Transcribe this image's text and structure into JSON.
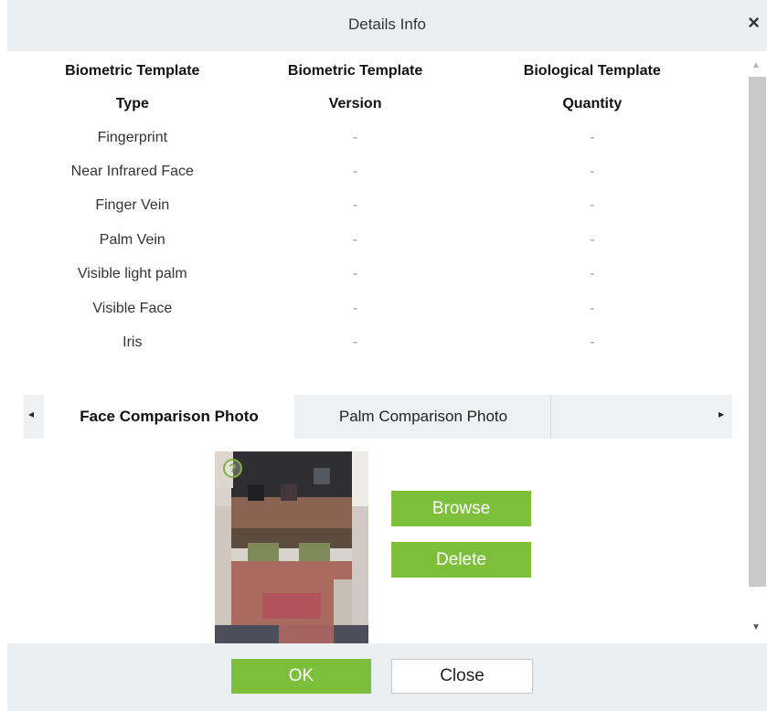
{
  "dialog": {
    "title": "Details Info",
    "close_glyph": "×"
  },
  "table": {
    "headers": [
      {
        "line1": "Biometric Template",
        "line2": "Type"
      },
      {
        "line1": "Biometric Template",
        "line2": "Version"
      },
      {
        "line1": "Biological Template",
        "line2": "Quantity"
      }
    ],
    "rows": [
      {
        "type": "Fingerprint",
        "version": "-",
        "quantity": "-"
      },
      {
        "type": "Near Infrared Face",
        "version": "-",
        "quantity": "-"
      },
      {
        "type": "Finger Vein",
        "version": "-",
        "quantity": "-"
      },
      {
        "type": "Palm Vein",
        "version": "-",
        "quantity": "-"
      },
      {
        "type": "Visible light palm",
        "version": "-",
        "quantity": "-"
      },
      {
        "type": "Visible Face",
        "version": "-",
        "quantity": "-"
      },
      {
        "type": "Iris",
        "version": "-",
        "quantity": "-"
      }
    ]
  },
  "tabs": {
    "left_arrow": "◂",
    "right_arrow": "▸",
    "items": [
      {
        "label": "Face Comparison Photo",
        "active": true
      },
      {
        "label": "Palm Comparison Photo",
        "active": false
      }
    ]
  },
  "photo": {
    "help_glyph": "?",
    "browse_label": "Browse",
    "delete_label": "Delete"
  },
  "footer": {
    "ok_label": "OK",
    "close_label": "Close"
  },
  "scrollbar": {
    "up_glyph": "▲",
    "down_glyph": "▼"
  },
  "colors": {
    "accent_green": "#7cbf3b",
    "header_bg": "#eaeef0"
  }
}
